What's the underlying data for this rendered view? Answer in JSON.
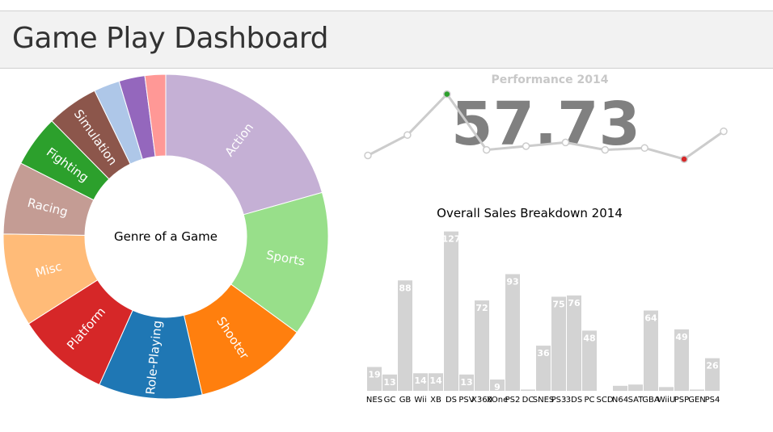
{
  "header": {
    "title": "Game Play Dashboard"
  },
  "colors": {
    "bar": "#d3d3d3",
    "kpi_value": "#808080",
    "kpi_title": "#c8c8c8",
    "spark_line": "#cccccc",
    "spark_max": "#2ca02c",
    "spark_min": "#d62728"
  },
  "donut": {
    "center_label": "Genre of a Game",
    "segments": [
      {
        "label": "Action",
        "value": 20,
        "color": "#c5b0d5"
      },
      {
        "label": "Sports",
        "value": 14,
        "color": "#98df8a"
      },
      {
        "label": "Shooter",
        "value": 11,
        "color": "#ff7f0e"
      },
      {
        "label": "Role-Playing",
        "value": 10,
        "color": "#1f77b4"
      },
      {
        "label": "Platform",
        "value": 9,
        "color": "#d62728"
      },
      {
        "label": "Misc",
        "value": 9,
        "color": "#ffbb78"
      },
      {
        "label": "Racing",
        "value": 7,
        "color": "#c49c94"
      },
      {
        "label": "Fighting",
        "value": 5,
        "color": "#2ca02c"
      },
      {
        "label": "Simulation",
        "value": 5,
        "color": "#8c564b"
      },
      {
        "label": "",
        "value": 2.5,
        "color": "#aec7e8"
      },
      {
        "label": "",
        "value": 2.5,
        "color": "#9467bd"
      },
      {
        "label": "",
        "value": 2,
        "color": "#ff9896"
      }
    ]
  },
  "kpi": {
    "title": "Performance 2014",
    "value": "57.73",
    "spark": [
      0.45,
      0.56,
      0.78,
      0.48,
      0.5,
      0.52,
      0.48,
      0.49,
      0.43,
      0.58
    ]
  },
  "chart_data": {
    "type": "bar",
    "title": "Overall Sales Breakdown 2014",
    "categories": [
      "NES",
      "GC",
      "GB",
      "Wii",
      "XB",
      "DS",
      "PSV",
      "X360",
      "XOne",
      "PS2",
      "DC",
      "SNES",
      "PS3",
      "3DS",
      "PC",
      "SCD",
      "N64",
      "SAT",
      "GBA",
      "WiiU",
      "PSP",
      "GEN",
      "PS4"
    ],
    "values": [
      19,
      13,
      88,
      14,
      14,
      127,
      13,
      72,
      9,
      93,
      1,
      36,
      75,
      76,
      48,
      0,
      4,
      5,
      64,
      3,
      49,
      1,
      26
    ],
    "ylim": [
      0,
      130
    ]
  }
}
